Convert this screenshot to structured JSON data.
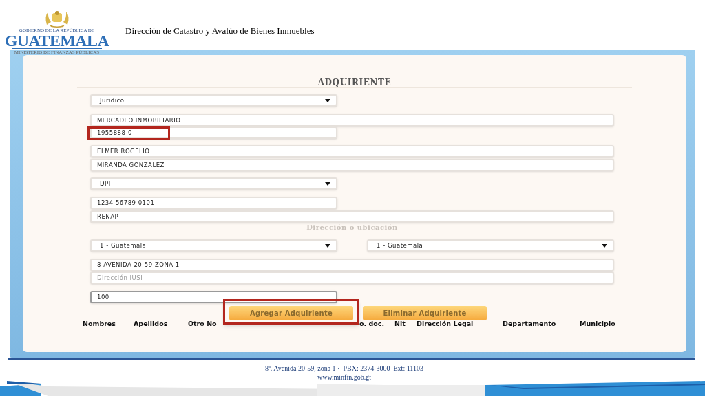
{
  "header": {
    "logo": {
      "top_text": "GOBIERNO DE LA REPÚBLICA DE",
      "name": "GUATEMALA",
      "bottom_text": "MINISTERIO DE FINANZAS PÚBLICAS"
    },
    "title": "Dirección de Catastro y Avalúo de Bienes Inmuebles"
  },
  "form": {
    "title": "ADQUIRIENTE",
    "person_fields": [
      {
        "kind": "select",
        "value": "Juridico"
      },
      {
        "kind": "input",
        "value": "MERCADEO INMOBILIARIO"
      },
      {
        "kind": "input",
        "value": "1955888-0",
        "highlighted": true
      },
      {
        "kind": "input",
        "value": "ELMER ROGELIO"
      },
      {
        "kind": "input",
        "value": "MIRANDA GONZALEZ"
      },
      {
        "kind": "select",
        "value": "DPI"
      },
      {
        "kind": "input",
        "value": "1234 56789 0101"
      },
      {
        "kind": "input",
        "value": "RENAP"
      }
    ],
    "location_label": "Dirección o ubicación",
    "location_selects": [
      {
        "value": "1 - Guatemala"
      },
      {
        "value": "1 - Guatemala"
      }
    ],
    "address_fields": [
      {
        "value": "8 AVENIDA 20-59 ZONA 1"
      },
      {
        "placeholder": "Dirección IUSI"
      },
      {
        "value": "100",
        "focused": true
      }
    ],
    "buttons": [
      {
        "label": "Agregar Adquiriente",
        "highlighted": true
      },
      {
        "label": "Eliminar Adquiriente",
        "highlighted": false
      }
    ],
    "table_columns": [
      "Nombres",
      "Apellidos",
      "Otro No",
      "o. doc.",
      "Nit",
      "Dirección Legal",
      "Departamento",
      "Municipio"
    ]
  },
  "footer": {
    "address": "8ª. Avenida 20-59, zona 1 ·  PBX: 2374-3000  Ext: 11103",
    "website": "www.minfin.gob.gt"
  }
}
